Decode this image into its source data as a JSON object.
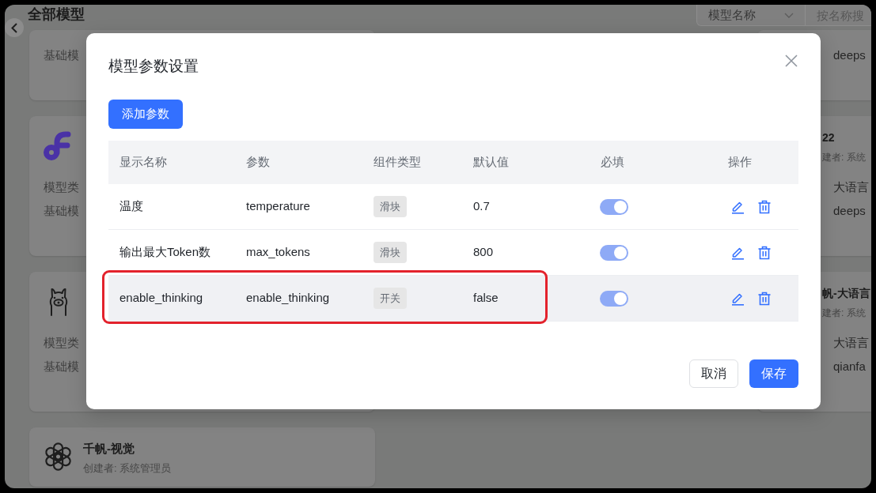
{
  "page": {
    "title": "全部模型",
    "model_select": {
      "value": "模型名称"
    },
    "search": {
      "placeholder": "按名称搜"
    },
    "card_columns": [
      {
        "cards": [
          {
            "rows": [
              {
                "label": "基础模"
              }
            ]
          },
          {
            "kind": "loop-logo",
            "rows": [
              {
                "label": "模型类"
              },
              {
                "label": "基础模"
              }
            ]
          },
          {
            "kind": "llama",
            "rows": [
              {
                "label": "模型类"
              },
              {
                "label": "基础模"
              }
            ]
          },
          {
            "kind": "knot-logo",
            "name": "千帆-视觉",
            "creator": "创建者: 系统管理员"
          }
        ]
      },
      {
        "cards": [
          {
            "rows": [
              {
                "value": "deeps"
              }
            ]
          },
          {
            "name": "22",
            "creator": "建者: 系统",
            "rows": [
              {
                "value": "大语言"
              },
              {
                "value": "deeps"
              }
            ]
          },
          {
            "name": "帆-大语言",
            "creator": "建者: 系统",
            "rows": [
              {
                "value": "大语言"
              },
              {
                "value": "qianfa"
              }
            ]
          }
        ]
      }
    ]
  },
  "dialog": {
    "title": "模型参数设置",
    "add_button": "添加参数",
    "table": {
      "columns": [
        "显示名称",
        "参数",
        "组件类型",
        "默认值",
        "必填",
        "操作"
      ],
      "rows": [
        {
          "display_name": "温度",
          "parameter": "temperature",
          "component_type": "滑块",
          "default_value": "0.7",
          "required": true,
          "hovered": false,
          "highlighted": false
        },
        {
          "display_name": "输出最大Token数",
          "parameter": "max_tokens",
          "component_type": "滑块",
          "default_value": "800",
          "required": true,
          "hovered": false,
          "highlighted": false
        },
        {
          "display_name": "enable_thinking",
          "parameter": "enable_thinking",
          "component_type": "开关",
          "default_value": "false",
          "required": true,
          "hovered": true,
          "highlighted": true
        }
      ]
    },
    "buttons": [
      {
        "label": "取消",
        "kind": "secondary"
      },
      {
        "label": "保存",
        "kind": "primary"
      }
    ]
  }
}
